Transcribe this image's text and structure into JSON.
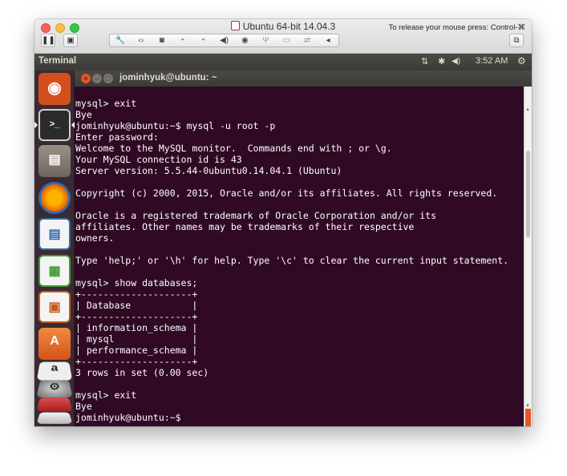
{
  "window": {
    "title": "Ubuntu 64-bit 14.04.3",
    "release_hint": "To release your mouse press: Control-⌘"
  },
  "vm_toolbar": {
    "pause_icon": "pause-icon",
    "snapshot_icon": "snapshot-icon",
    "devices": [
      "wrench-icon",
      "network-icon",
      "disk-icon",
      "camera-icon",
      "printer-icon",
      "sound-icon",
      "cd-icon",
      "usb-icon",
      "floppy-icon",
      "share-icon"
    ],
    "collapse_icon": "chevron-left-icon",
    "fullscreen_icon": "window-icon"
  },
  "unity_panel": {
    "app_name": "Terminal",
    "indicators": {
      "network": "⇅",
      "bluetooth": "✱",
      "volume": "🔊",
      "time": "3:52 AM",
      "settings": "⚙"
    }
  },
  "launcher": {
    "items": [
      {
        "name": "ubuntu-dash",
        "glyph": "◉",
        "color": "#e95420"
      },
      {
        "name": "terminal",
        "glyph": ">_",
        "color": "#2b2b2b"
      },
      {
        "name": "files",
        "glyph": "▤",
        "color": "#8a8174"
      },
      {
        "name": "firefox",
        "glyph": "◍",
        "color": "#e66000"
      },
      {
        "name": "libreoffice-writer",
        "glyph": "▦",
        "color": "#2a6aa8"
      },
      {
        "name": "libreoffice-calc",
        "glyph": "▦",
        "color": "#3e9a34"
      },
      {
        "name": "libreoffice-impress",
        "glyph": "▦",
        "color": "#c75a1c"
      },
      {
        "name": "ubuntu-software-center",
        "glyph": "A",
        "color": "#e46d21"
      },
      {
        "name": "amazon",
        "glyph": "a",
        "color": "#e5e5e5"
      },
      {
        "name": "system-settings",
        "glyph": "⚙",
        "color": "#6b6b6b"
      }
    ]
  },
  "terminal": {
    "title": "jominhyuk@ubuntu: ~",
    "lines": [
      "mysql> exit",
      "Bye",
      "jominhyuk@ubuntu:~$ mysql -u root -p",
      "Enter password:",
      "Welcome to the MySQL monitor.  Commands end with ; or \\g.",
      "Your MySQL connection id is 43",
      "Server version: 5.5.44-0ubuntu0.14.04.1 (Ubuntu)",
      "",
      "Copyright (c) 2000, 2015, Oracle and/or its affiliates. All rights reserved.",
      "",
      "Oracle is a registered trademark of Oracle Corporation and/or its",
      "affiliates. Other names may be trademarks of their respective",
      "owners.",
      "",
      "Type 'help;' or '\\h' for help. Type '\\c' to clear the current input statement.",
      "",
      "mysql> show databases;",
      "+--------------------+",
      "| Database           |",
      "+--------------------+",
      "| information_schema |",
      "| mysql              |",
      "| performance_schema |",
      "+--------------------+",
      "3 rows in set (0.00 sec)",
      "",
      "mysql> exit",
      "Bye",
      "jominhyuk@ubuntu:~$ "
    ]
  }
}
